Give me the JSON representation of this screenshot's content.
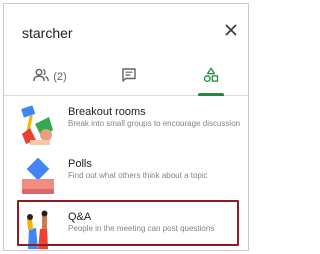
{
  "panel": {
    "title": "starcher"
  },
  "tabs": {
    "people": {
      "count": "(2)"
    },
    "chat": {},
    "activities": {}
  },
  "activities": [
    {
      "title": "Breakout rooms",
      "description": "Break into small groups to encourage discussion"
    },
    {
      "title": "Polls",
      "description": "Find out what others think about a topic"
    },
    {
      "title": "Q&A",
      "description": "People in the meeting can post questions"
    }
  ],
  "colors": {
    "accent_green": "#1e8e3e",
    "highlight_border": "#8a1c24",
    "text_primary": "#202124",
    "text_secondary": "#80868b"
  },
  "icons": {
    "close": "close-icon",
    "people": "people-icon",
    "chat": "chat-icon",
    "activities": "shapes-icon"
  }
}
